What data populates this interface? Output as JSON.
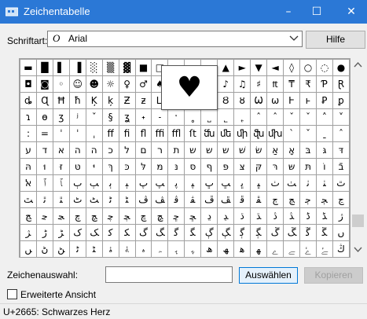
{
  "window": {
    "title": "Zeichentabelle",
    "minimize": "–",
    "maximize": "☐",
    "close": "✕"
  },
  "font": {
    "label": "Schriftart:",
    "icon": "O",
    "name": "Arial"
  },
  "buttons": {
    "help": "Hilfe",
    "select": "Auswählen",
    "copy": "Kopieren"
  },
  "grid": {
    "rows": [
      [
        "▬",
        "█",
        "▌",
        "▐",
        "░",
        "▒",
        "▓",
        "■",
        "□",
        "▪",
        "▫",
        "▬",
        "▲",
        "►",
        "▼",
        "◄",
        "◊",
        "○",
        "◌",
        "●"
      ],
      [
        "◘",
        "◙",
        "◦",
        "☺",
        "☻",
        "☼",
        "♀",
        "♂",
        "♠",
        "♣",
        "♥",
        "♦",
        "♪",
        "♫",
        "♯",
        "₶",
        "₸",
        "₹",
        "Ƥ",
        "Ɽ"
      ],
      [
        "ȡ",
        "Ɋ",
        "Ħ",
        "ħ",
        "Ķ",
        "ķ",
        "Ƶ",
        "ƶ",
        "ǈ",
        "ǉ",
        "ǳ",
        "Ƿ",
        "Ȣ",
        "ȣ",
        "Ѡ",
        "ѡ",
        "Ⱶ",
        "ⱶ",
        "Ꝑ",
        "ꝑ"
      ],
      [
        "ɿ",
        "ɵ",
        "ʒ",
        "ʲ",
        "ˇ",
        "§",
        "ʓ",
        "˖",
        "˗",
        "ˑ",
        "˳",
        "˽",
        "˾",
        "˿",
        "ˆ",
        "ˆ",
        "ˇ",
        "ˇ",
        "˄",
        "˅"
      ],
      [
        ":",
        "=",
        "ˈ",
        "ˈ",
        "ˌ",
        "ff",
        "fi",
        "fl",
        "ffi",
        "ffl",
        "ſt",
        "ﬓ",
        "ﬔ",
        "ﬕ",
        "ﬖ",
        "ﬗ",
        "ˋ",
        "ˇ",
        "ˍ",
        "ˆ"
      ],
      [
        "ע",
        "ד",
        "א",
        "ה",
        "ה",
        "כ",
        "ל",
        "ם",
        "ר",
        "ת",
        "ש",
        "ש",
        "ש",
        "שׁ",
        "שׂ",
        "אַ",
        "אָ",
        "בּ",
        "גּ",
        "דּ"
      ],
      [
        "הּ",
        "וּ",
        "זּ",
        "טּ",
        "יּ",
        "ךּ",
        "כּ",
        "לּ",
        "מּ",
        "נּ",
        "סּ",
        "ףּ",
        "פּ",
        "צּ",
        "קּ",
        "רּ",
        "שּ",
        "תּ",
        "וֹ",
        "בֿ"
      ],
      [
        "ﭏ",
        "ﭐ",
        "ﭑ",
        "ﭒ",
        "ﭓ",
        "ﭔ",
        "ﭕ",
        "ﭖ",
        "ﭗ",
        "ﭘ",
        "ﭙ",
        "ﭚ",
        "ﭛ",
        "ﭜ",
        "ﭝ",
        "ﭞ",
        "ﭟ",
        "ﭠ",
        "ﭡ",
        "ﭢ"
      ],
      [
        "ﭣ",
        "ﭤ",
        "ﭥ",
        "ﭦ",
        "ﭧ",
        "ﭨ",
        "ﭩ",
        "ﭪ",
        "ﭫ",
        "ﭬ",
        "ﭭ",
        "ﭮ",
        "ﭯ",
        "ﭰ",
        "ﭱ",
        "ﭲ",
        "ﭳ",
        "ﭴ",
        "ﭵ",
        "ﭶ"
      ],
      [
        "ﭷ",
        "ﭸ",
        "ﭹ",
        "ﭺ",
        "ﭻ",
        "ﭼ",
        "ﭽ",
        "ﭾ",
        "ﭿ",
        "ﮀ",
        "ﮁ",
        "ﮂ",
        "ﮃ",
        "ﮄ",
        "ﮅ",
        "ﮆ",
        "ﮇ",
        "ﮈ",
        "ﮉ",
        "ﮊ"
      ],
      [
        "ﮋ",
        "ﮌ",
        "ﮍ",
        "ﮎ",
        "ﮏ",
        "ﮐ",
        "ﮑ",
        "ﮒ",
        "ﮓ",
        "ﮔ",
        "ﮕ",
        "ﮖ",
        "ﮗ",
        "ﮘ",
        "ﮙ",
        "ﮚ",
        "ﮛ",
        "ﮜ",
        "ﮝ",
        "ﮞ"
      ],
      [
        "ﮟ",
        "ﮠ",
        "ﮡ",
        "ﮢ",
        "ﮣ",
        "ﮤ",
        "ﮥ",
        "ﮦ",
        "ﮧ",
        "ﮨ",
        "ﮩ",
        "ﮪ",
        "ﮫ",
        "ﮬ",
        "ﮭ",
        "ﮮ",
        "ﮯ",
        "ﮰ",
        "ﮱ",
        "ﯓ"
      ]
    ],
    "enlarged": "♥"
  },
  "selection": {
    "label": "Zeichenauswahl:",
    "value": ""
  },
  "advanced": {
    "label": "Erweiterte Ansicht"
  },
  "status": {
    "text": "U+2665: Schwarzes Herz"
  }
}
